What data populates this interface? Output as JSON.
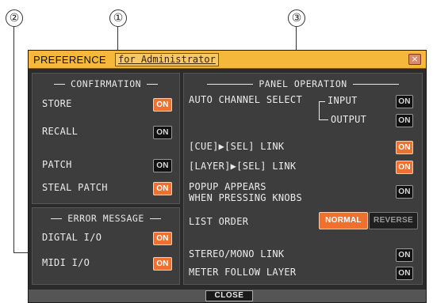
{
  "callouts": {
    "c1": "①",
    "c2": "②",
    "c3": "③"
  },
  "window": {
    "title": "PREFERENCE",
    "subtitle": "for Administrator",
    "close_icon": "close-x-icon"
  },
  "confirmation": {
    "title": "CONFIRMATION",
    "items": [
      {
        "label": "STORE",
        "state": "ON",
        "active": true
      },
      {
        "label": "RECALL",
        "state": "ON",
        "active": false
      },
      {
        "label": "PATCH",
        "state": "ON",
        "active": false
      },
      {
        "label": "STEAL PATCH",
        "state": "ON",
        "active": true
      }
    ]
  },
  "error_message": {
    "title": "ERROR MESSAGE",
    "items": [
      {
        "label": "DIGTAL I/O",
        "state": "ON",
        "active": true
      },
      {
        "label": "MIDI I/O",
        "state": "ON",
        "active": true
      }
    ]
  },
  "panel_operation": {
    "title": "PANEL OPERATION",
    "auto_channel_select": {
      "label": "AUTO CHANNEL SELECT",
      "input_label": "INPUT",
      "input_state": "ON",
      "input_active": false,
      "output_label": "OUTPUT",
      "output_state": "ON",
      "output_active": false
    },
    "cue_sel_link": {
      "label": "[CUE]▶[SEL] LINK",
      "state": "ON",
      "active": true
    },
    "layer_sel_link": {
      "label": "[LAYER]▶[SEL] LINK",
      "state": "ON",
      "active": true
    },
    "popup": {
      "label_line1": "POPUP APPEARS",
      "label_line2": "WHEN PRESSING KNOBS",
      "state": "ON",
      "active": false
    },
    "list_order": {
      "label": "LIST ORDER",
      "options": [
        "NORMAL",
        "REVERSE"
      ],
      "selected": "NORMAL"
    },
    "stereo_mono_link": {
      "label": "STEREO/MONO LINK",
      "state": "ON",
      "active": false
    },
    "meter_follow_layer": {
      "label": "METER FOLLOW LAYER",
      "state": "ON",
      "active": false
    }
  },
  "footer": {
    "close_label": "CLOSE"
  },
  "colors": {
    "titlebar": "#f6b83a",
    "panel": "#3d3d3d",
    "window": "#2b2b2b",
    "on_button": "#f07030",
    "off_button": "#121212"
  }
}
